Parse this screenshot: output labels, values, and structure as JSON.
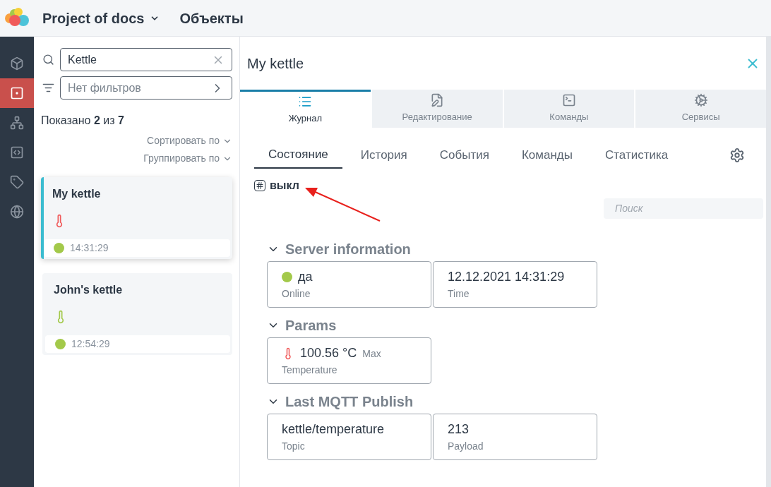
{
  "header": {
    "project": "Project of docs",
    "section": "Объекты"
  },
  "nav": [
    {
      "kind": "cube",
      "selected": false
    },
    {
      "kind": "target",
      "selected": true
    },
    {
      "kind": "tree",
      "selected": false
    },
    {
      "kind": "code",
      "selected": false
    },
    {
      "kind": "tag",
      "selected": false
    },
    {
      "kind": "globe",
      "selected": false
    }
  ],
  "search": {
    "value": "Kettle"
  },
  "filter": {
    "placeholder": "Нет фильтров"
  },
  "shown": "Показано **2** из **7**",
  "sort": "Сортировать по",
  "group": "Группировать по",
  "objects": [
    {
      "name": "My kettle",
      "time": "14:31:29",
      "selected": true,
      "sensor": {
        "color": "#f05a5a"
      },
      "status": {
        "color": "#a3c94a"
      }
    },
    {
      "name": "John's kettle",
      "time": "12:54:29",
      "selected": false,
      "sensor": {
        "color": "#a3c94a"
      },
      "status": {
        "color": "#a3c94a"
      }
    }
  ],
  "detail": {
    "title": "My kettle",
    "tabs": [
      {
        "label": "Журнал",
        "kind": "list",
        "selected": true
      },
      {
        "label": "Редактирование",
        "kind": "edit",
        "selected": false
      },
      {
        "label": "Команды",
        "kind": "terminal",
        "selected": false
      },
      {
        "label": "Сервисы",
        "kind": "services",
        "selected": false
      }
    ],
    "subtabs": [
      {
        "label": "Состояние",
        "selected": true
      },
      {
        "label": "История",
        "selected": false
      },
      {
        "label": "События",
        "selected": false
      },
      {
        "label": "Команды",
        "selected": false
      },
      {
        "label": "Статистика",
        "selected": false
      }
    ],
    "state": "выкл",
    "search": {
      "placeholder": "Поиск"
    },
    "groups": [
      {
        "title": "Server information",
        "expanded": true,
        "cards": [
          {
            "kind": "status",
            "value": "да",
            "label": "Online",
            "color": "#a3c94a"
          },
          {
            "kind": "plain",
            "value": "12.12.2021 14:31:29",
            "label": "Time"
          }
        ]
      },
      {
        "title": "Params",
        "expanded": true,
        "cards": [
          {
            "kind": "temp",
            "value": "100.56 °C",
            "extra": "Max",
            "label": "Temperature",
            "color": "#f05a5a"
          }
        ]
      },
      {
        "title": "Last MQTT Publish",
        "expanded": true,
        "cards": [
          {
            "kind": "plain",
            "value": "kettle/temperature",
            "label": "Topic"
          },
          {
            "kind": "plain",
            "value": "213",
            "label": "Payload"
          }
        ]
      }
    ]
  }
}
